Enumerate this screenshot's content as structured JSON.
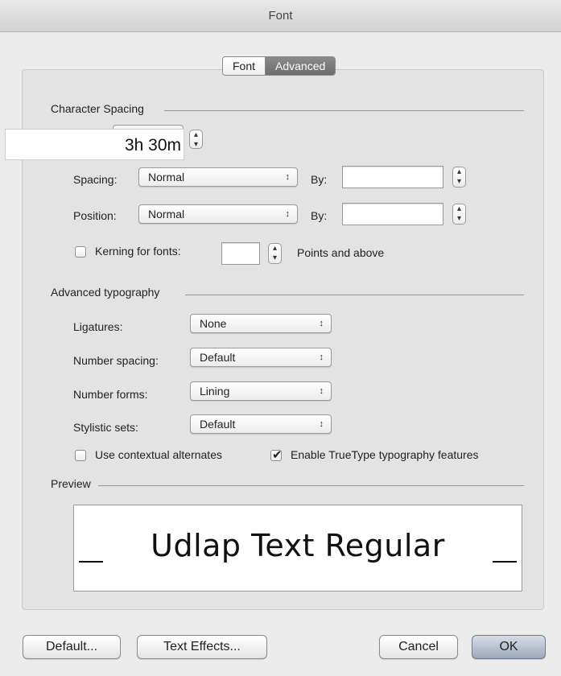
{
  "window": {
    "title": "Font"
  },
  "tabs": [
    {
      "label": "Font",
      "active": false
    },
    {
      "label": "Advanced",
      "active": true
    }
  ],
  "character_spacing": {
    "section_label": "Character Spacing",
    "scale_overlay_value": "3h 30m",
    "spacing": {
      "label": "Spacing:",
      "value": "Normal",
      "by_label": "By:",
      "by_value": ""
    },
    "position": {
      "label": "Position:",
      "value": "Normal",
      "by_label": "By:",
      "by_value": ""
    },
    "kerning": {
      "label": "Kerning for fonts:",
      "checked": false,
      "value": "",
      "suffix": "Points and above"
    }
  },
  "advanced_typography": {
    "section_label": "Advanced typography",
    "ligatures": {
      "label": "Ligatures:",
      "value": "None"
    },
    "number_spacing": {
      "label": "Number spacing:",
      "value": "Default"
    },
    "number_forms": {
      "label": "Number forms:",
      "value": "Lining"
    },
    "stylistic_sets": {
      "label": "Stylistic sets:",
      "value": "Default"
    },
    "contextual_alternates": {
      "label": "Use contextual alternates",
      "checked": false
    },
    "truetype_features": {
      "label": "Enable TrueType typography features",
      "checked": true
    }
  },
  "preview": {
    "section_label": "Preview",
    "sample_text": "Udlap Text Regular"
  },
  "buttons": {
    "default": "Default...",
    "text_effects": "Text Effects...",
    "cancel": "Cancel",
    "ok": "OK"
  },
  "icons": {
    "popup_arrows": "↕",
    "stepper_up": "▴",
    "stepper_down": "▾",
    "checkmark": "✔"
  }
}
